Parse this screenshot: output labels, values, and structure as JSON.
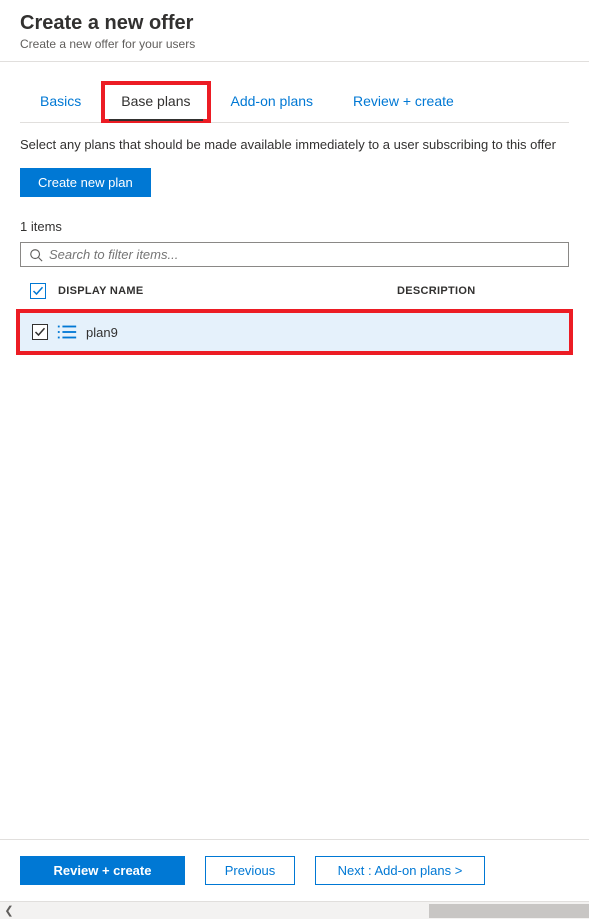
{
  "header": {
    "title": "Create a new offer",
    "subtitle": "Create a new offer for your users"
  },
  "tabs": [
    {
      "label": "Basics",
      "active": false
    },
    {
      "label": "Base plans",
      "active": true
    },
    {
      "label": "Add-on plans",
      "active": false
    },
    {
      "label": "Review + create",
      "active": false
    }
  ],
  "content": {
    "description": "Select any plans that should be made available immediately to a user subscribing to this offer",
    "create_button": "Create new plan",
    "items_count": "1 items",
    "search_placeholder": "Search to filter items...",
    "columns": {
      "display_name": "DISPLAY NAME",
      "description": "DESCRIPTION"
    },
    "rows": [
      {
        "name": "plan9",
        "description": "",
        "checked": true
      }
    ]
  },
  "footer": {
    "review": "Review + create",
    "previous": "Previous",
    "next": "Next : Add-on plans >"
  }
}
